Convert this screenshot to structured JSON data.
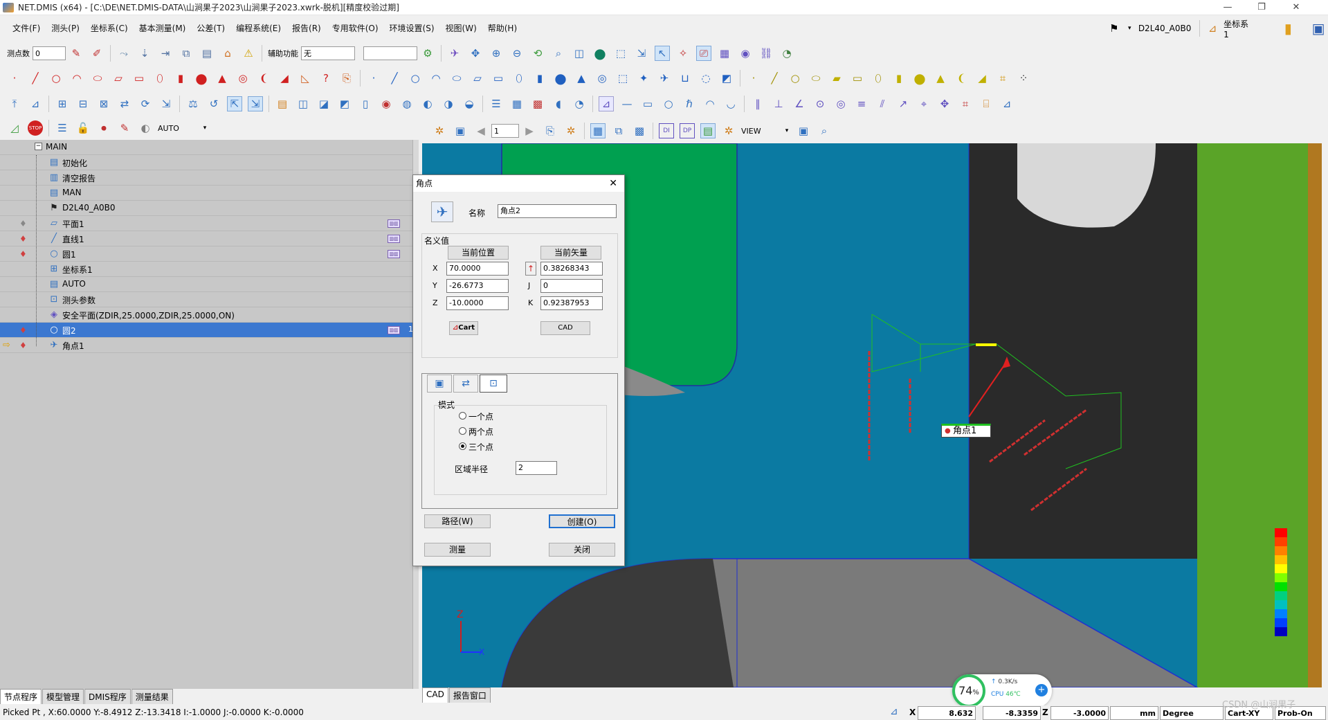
{
  "window": {
    "title": "NET.DMIS (x64) - [C:\\DE\\NET.DMIS-DATA\\山涧果子2023\\山涧果子2023.xwrk-脱机][精度校验过期]",
    "controls": [
      "—",
      "❐",
      "✕"
    ]
  },
  "menu": [
    "文件(F)",
    "测头(P)",
    "坐标系(C)",
    "基本测量(M)",
    "公差(T)",
    "编程系统(E)",
    "报告(R)",
    "专用软件(O)",
    "环境设置(S)",
    "视图(W)",
    "帮助(H)"
  ],
  "right_tools": {
    "probe": "D2L40_A0B0",
    "coord": "坐标系1"
  },
  "toolbar1": {
    "points_label": "测点数",
    "points_value": "0",
    "aux_label": "辅助功能",
    "aux_value": "无",
    "extra_value": ""
  },
  "toolbar4": {
    "mode": "AUTO"
  },
  "view_toolbar": {
    "page": "1",
    "view": "VIEW"
  },
  "tree": [
    {
      "label": "MAIN",
      "icon": "folder-icon",
      "level": 0
    },
    {
      "label": "初始化",
      "icon": "init-icon",
      "level": 1
    },
    {
      "label": "清空报告",
      "icon": "clear-report-icon",
      "level": 1
    },
    {
      "label": "MAN",
      "icon": "mode-icon",
      "level": 1
    },
    {
      "label": "D2L40_A0B0",
      "icon": "probe-icon",
      "level": 1
    },
    {
      "label": "平面1",
      "icon": "plane-icon",
      "level": 1,
      "tag": true
    },
    {
      "label": "直线1",
      "icon": "line-icon",
      "level": 1,
      "tag": true
    },
    {
      "label": "圆1",
      "icon": "circle-icon",
      "level": 1,
      "tag": true
    },
    {
      "label": "坐标系1",
      "icon": "coord-icon",
      "level": 1
    },
    {
      "label": "AUTO",
      "icon": "mode-icon",
      "level": 1
    },
    {
      "label": "测头参数",
      "icon": "probe-param-icon",
      "level": 1
    },
    {
      "label": "安全平面(ZDIR,25.0000,ZDIR,25.0000,ON)",
      "icon": "safe-plane-icon",
      "level": 1
    },
    {
      "label": "圆2",
      "icon": "circle-icon",
      "level": 1,
      "tag": true,
      "selected": true,
      "badge": "1"
    },
    {
      "label": "角点1",
      "icon": "corner-icon",
      "level": 1,
      "current": true
    }
  ],
  "left_tabs": [
    "节点程序",
    "模型管理",
    "DMIS程序",
    "测量结果"
  ],
  "cad_tabs": [
    "CAD",
    "报告窗口"
  ],
  "dialog": {
    "title": "角点",
    "name_label": "名称",
    "name_value": "角点2",
    "nominal_label": "名义值",
    "cur_pos_button": "当前位置",
    "cur_vec_button": "当前矢量",
    "x_label": "X",
    "x_value": "70.0000",
    "y_label": "Y",
    "y_value": "-26.6773",
    "z_label": "Z",
    "z_value": "-10.0000",
    "i_value": "0.38268343",
    "j_label": "J",
    "j_value": "0",
    "k_label": "K",
    "k_value": "0.92387953",
    "cart_button": "Cart",
    "cad_button": "CAD",
    "mode_label": "模式",
    "mode_options": [
      "一个点",
      "两个点",
      "三个点"
    ],
    "mode_selected": 2,
    "radius_label": "区域半径",
    "radius_value": "2",
    "path_button": "路径(W)",
    "create_button": "创建(O)",
    "measure_button": "测量",
    "close_button": "关闭"
  },
  "cad": {
    "callout": "角点1",
    "axis_z": "Z",
    "axis_x": "X",
    "color_scale": [
      "#ff0000",
      "#ff4000",
      "#ff8000",
      "#ffc000",
      "#ffff00",
      "#80ff00",
      "#00e000",
      "#00d080",
      "#00c0c0",
      "#0080ff",
      "#0040ff",
      "#0000c0"
    ]
  },
  "perf": {
    "cpu_percent": "74",
    "unit": "%",
    "net": "0.3K/s",
    "cpu_label": "CPU",
    "temp": "46℃"
  },
  "status": {
    "picked": "Picked Pt , X:60.0000 Y:-8.4912 Z:-13.3418  I:-1.0000  J:-0.0000  K:-0.0000",
    "x_label": "X",
    "x_value": "8.632",
    "y_value": "-8.3359",
    "z_label": "Z",
    "z_value": "-3.0000",
    "unit": "mm",
    "angle": "Degree",
    "coord_mode": "Cart-XY",
    "probe_mode": "Prob-On",
    "watermark": "CSDN @山涧果子"
  }
}
